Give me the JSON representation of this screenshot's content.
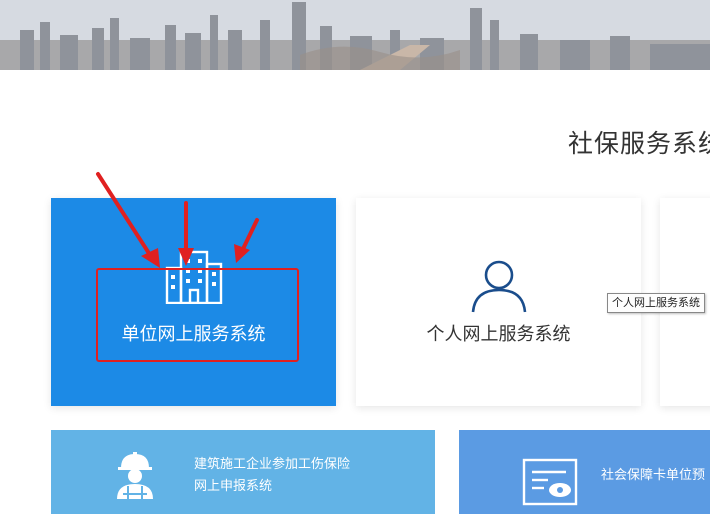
{
  "section": {
    "title": "社保服务系统"
  },
  "cards": [
    {
      "label": "单位网上服务系统",
      "icon": "building-icon"
    },
    {
      "label": "个人网上服务系统",
      "icon": "person-icon"
    }
  ],
  "tooltip": {
    "text": "个人网上服务系统"
  },
  "tiles": [
    {
      "line1": "建筑施工企业参加工伤保险",
      "line2": "网上申报系统",
      "icon": "worker-helmet-icon"
    },
    {
      "line1": "社会保障卡单位预",
      "icon": "social-security-card-icon"
    }
  ],
  "colors": {
    "unit_card": "#1c8ae6",
    "annotation": "#e02020",
    "tile_left": "#62b3e6",
    "tile_right": "#5b9be3"
  }
}
